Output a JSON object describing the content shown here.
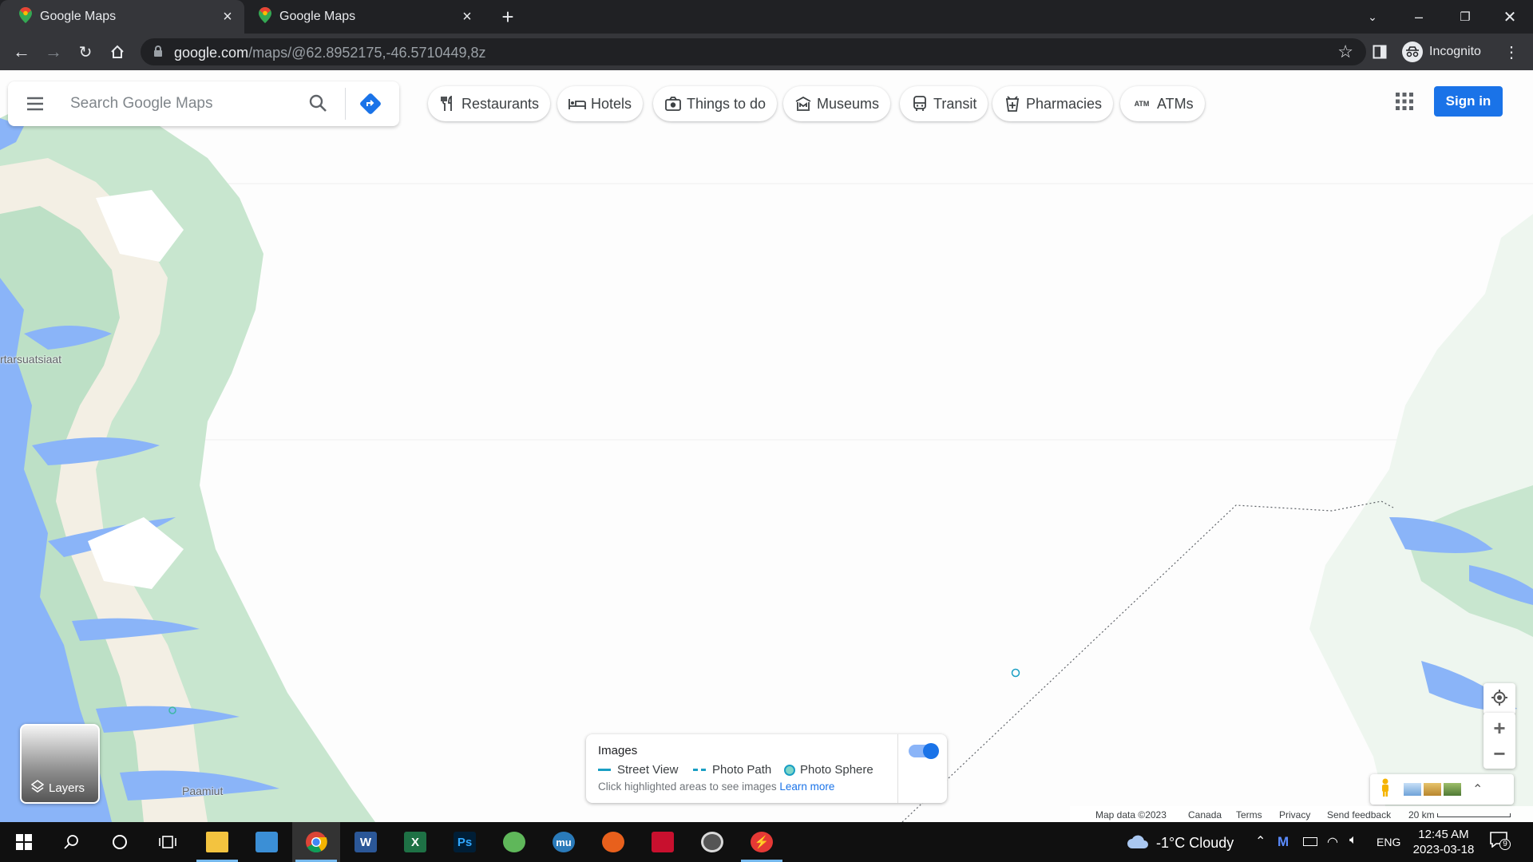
{
  "browser": {
    "tabs": [
      {
        "title": "Google Maps"
      },
      {
        "title": "Google Maps"
      }
    ],
    "new_tab_icon": "plus-icon",
    "url_host": "google.com",
    "url_path": "/maps/@62.8952175,-46.5710449,8z",
    "profile_label": "Incognito"
  },
  "search": {
    "placeholder": "Search Google Maps"
  },
  "chips": [
    {
      "label": "Restaurants",
      "icon": "fork-knife-icon"
    },
    {
      "label": "Hotels",
      "icon": "bed-icon"
    },
    {
      "label": "Things to do",
      "icon": "camera-icon"
    },
    {
      "label": "Museums",
      "icon": "museum-icon"
    },
    {
      "label": "Transit",
      "icon": "bus-icon"
    },
    {
      "label": "Pharmacies",
      "icon": "pharmacy-icon"
    },
    {
      "label": "ATMs",
      "icon": "atm-icon"
    }
  ],
  "atm_glyph": "ATM",
  "sign_in_label": "Sign in",
  "layers_label": "Layers",
  "images_panel": {
    "title": "Images",
    "street_view": "Street View",
    "photo_path": "Photo Path",
    "photo_sphere": "Photo Sphere",
    "hint": "Click highlighted areas to see images",
    "learn_more": "Learn more",
    "toggle_on": true
  },
  "map_labels": {
    "place1": "rtarsuatsiaat",
    "place2": "Paamiut"
  },
  "footer": {
    "map_data": "Map data ©2023",
    "country": "Canada",
    "terms": "Terms",
    "privacy": "Privacy",
    "feedback": "Send feedback",
    "scale": "20 km"
  },
  "taskbar": {
    "weather": "-1°C  Cloudy",
    "language": "ENG",
    "time": "12:45 AM",
    "date": "2023-03-18",
    "notification_count": "9"
  },
  "colors": {
    "water": "#8ab4f8",
    "land_green": "#c3e6cb",
    "land_tan": "#f1ece0",
    "accent": "#1a73e8"
  }
}
